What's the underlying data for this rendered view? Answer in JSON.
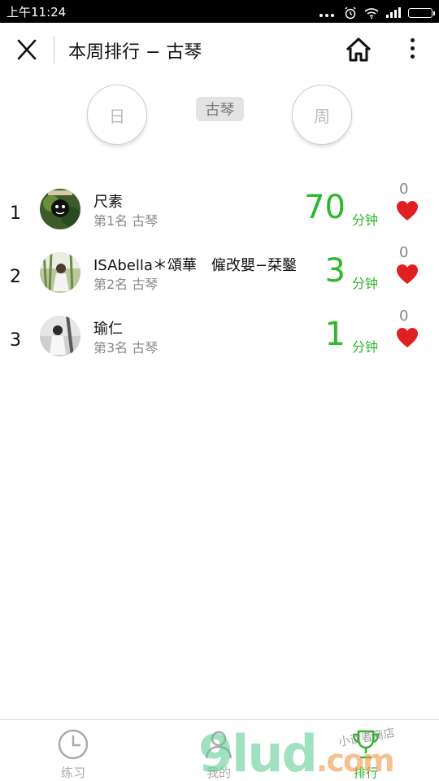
{
  "status_bar": {
    "time": "上午11:24"
  },
  "header": {
    "title": "本周排行 − 古琴"
  },
  "period_selector": {
    "day_label": "日",
    "category_label": "古琴",
    "week_label": "周"
  },
  "rankings": [
    {
      "rank": "1",
      "name": "尺素",
      "subtitle": "第1名 古琴",
      "minutes": "70",
      "unit": "分钟",
      "likes": "0"
    },
    {
      "rank": "2",
      "name": "ISAbella＊頌華　僱改嬰−栞鑿",
      "subtitle": "第2名 古琴",
      "minutes": "3",
      "unit": "分钟",
      "likes": "0"
    },
    {
      "rank": "3",
      "name": "瑜仁",
      "subtitle": "第3名 古琴",
      "minutes": "1",
      "unit": "分钟",
      "likes": "0"
    }
  ],
  "bottom_nav": [
    {
      "label": "练习",
      "icon": "clock-icon"
    },
    {
      "label": "我的",
      "icon": "user-icon"
    },
    {
      "label": "排行",
      "icon": "trophy-icon",
      "active": true
    }
  ],
  "watermark": {
    "main": "9lud",
    "suffix": ".com",
    "small": "小读者商店"
  },
  "colors": {
    "accent_green": "#2db82d",
    "heart_red": "#e02020",
    "muted_gray": "#888888"
  }
}
